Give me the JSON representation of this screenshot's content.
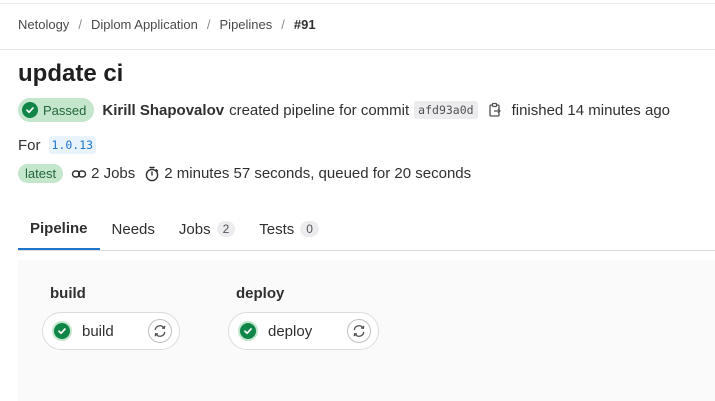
{
  "breadcrumb": {
    "items": [
      "Netology",
      "Diplom Application",
      "Pipelines"
    ],
    "current": "#91",
    "separator": "/"
  },
  "pipeline": {
    "title": "update ci",
    "status_label": "Passed",
    "author": "Kirill Shapovalov",
    "action_text": "created pipeline for commit",
    "commit_sha": "afd93a0d",
    "finished_text": "finished 14 minutes ago",
    "for_label": "For",
    "ref": "1.0.13",
    "latest_badge": "latest",
    "jobs_count": "2 Jobs",
    "duration_text": "2 minutes 57 seconds, queued for 20 seconds"
  },
  "tabs": [
    {
      "label": "Pipeline",
      "active": true
    },
    {
      "label": "Needs"
    },
    {
      "label": "Jobs",
      "count": "2"
    },
    {
      "label": "Tests",
      "count": "0"
    }
  ],
  "stages": [
    {
      "title": "build",
      "job": "build",
      "status": "success"
    },
    {
      "title": "deploy",
      "job": "deploy",
      "status": "success"
    }
  ],
  "colors": {
    "success": "#108548",
    "success_bg": "#c3e6cd",
    "link": "#1f75cb",
    "tab_active": "#1f75cb"
  },
  "icons": {
    "status": "check-circle-icon",
    "copy": "copy-to-clipboard-icon",
    "jobs": "link-icon",
    "duration": "timer-icon",
    "retry": "retry-icon"
  }
}
